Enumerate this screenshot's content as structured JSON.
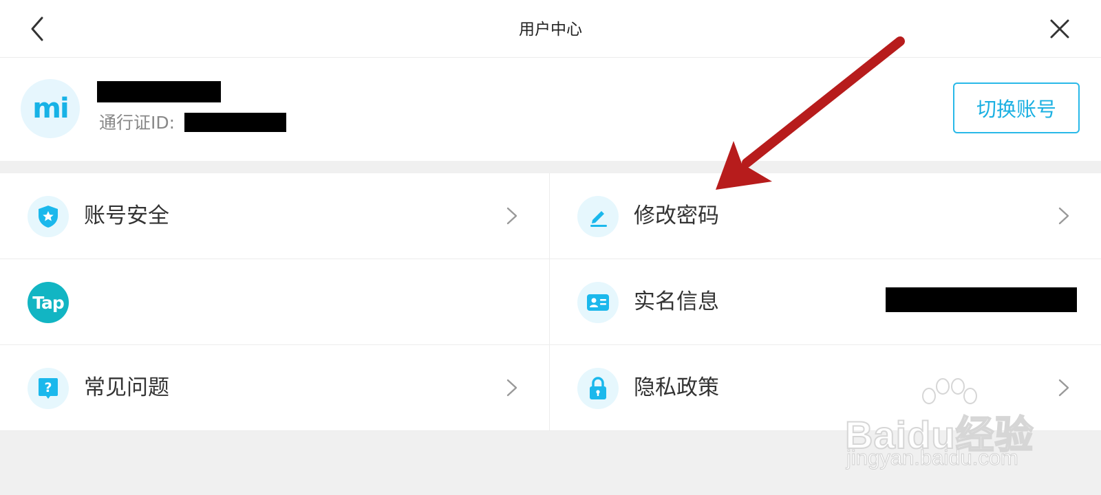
{
  "header": {
    "title": "用户中心",
    "back_icon": "chevron-left-icon",
    "close_icon": "close-icon"
  },
  "profile": {
    "avatar_text": "mi",
    "username": "",
    "pass_id_label": "通行证ID:",
    "pass_id_value": "",
    "switch_button": "切换账号"
  },
  "menu": {
    "items": [
      {
        "label": "账号安全",
        "icon": "shield-star-icon"
      },
      {
        "label": "修改密码",
        "icon": "pencil-icon"
      },
      {
        "label": "",
        "icon": "tap-logo-icon"
      },
      {
        "label": "实名信息",
        "icon": "id-card-icon"
      },
      {
        "label": "常见问题",
        "icon": "question-icon"
      },
      {
        "label": "隐私政策",
        "icon": "lock-icon"
      }
    ]
  },
  "tap_logo_text": "Tap",
  "watermark": {
    "main": "Baidu经验",
    "sub": "jingyan.baidu.com"
  },
  "colors": {
    "accent": "#1bb0e2",
    "icon_bg": "#e6f7fd",
    "arrow": "#b71c1c",
    "tap_green": "#12b5c3"
  }
}
